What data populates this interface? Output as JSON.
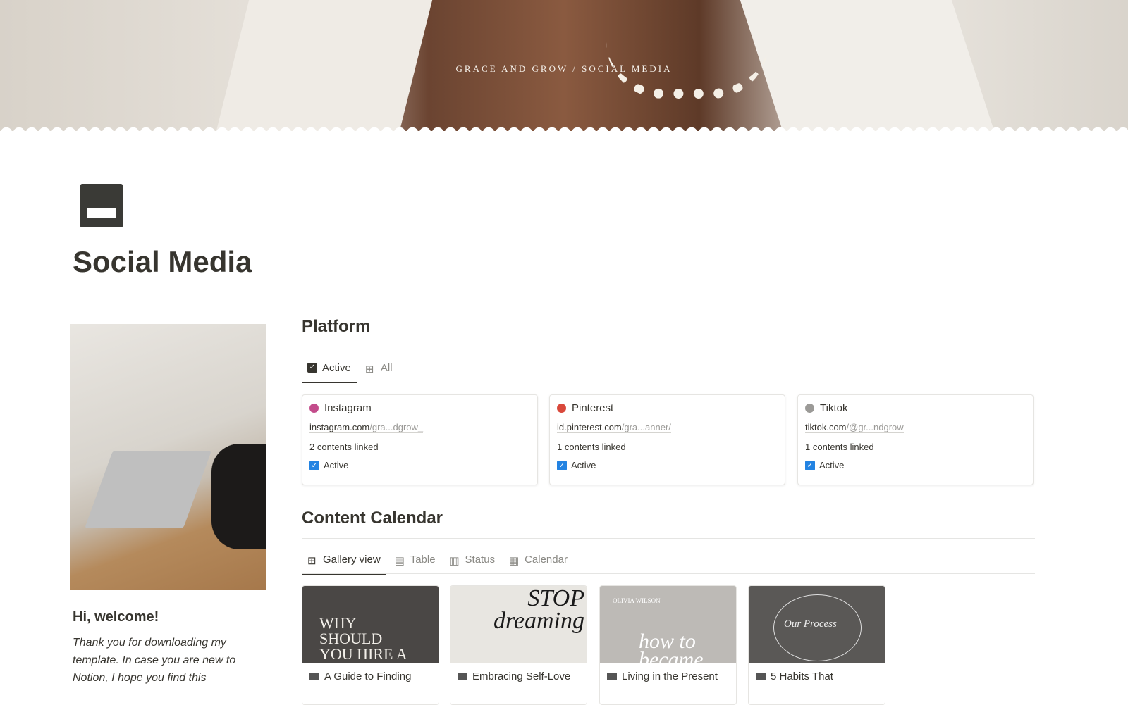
{
  "banner": {
    "title": "GRACE AND GROW / SOCIAL MEDIA"
  },
  "page": {
    "icon": "ticket-icon",
    "title": "Social Media"
  },
  "sidebar": {
    "welcome_title": "Hi, welcome!",
    "welcome_text": "Thank you for downloading my template. In case you are new to Notion, I hope you find this"
  },
  "platform": {
    "heading": "Platform",
    "tabs": [
      {
        "label": "Active",
        "icon": "checkbox-icon"
      },
      {
        "label": "All",
        "icon": "gallery-icon"
      }
    ],
    "cards": [
      {
        "name": "Instagram",
        "color": "#c34c8b",
        "url_domain": "instagram.com",
        "url_path": "/gra...dgrow_",
        "linked": "2 contents linked",
        "status": "Active"
      },
      {
        "name": "Pinterest",
        "color": "#d9483b",
        "url_domain": "id.pinterest.com",
        "url_path": "/gra...anner/",
        "linked": "1 contents linked",
        "status": "Active"
      },
      {
        "name": "Tiktok",
        "color": "#9b9a97",
        "url_domain": "tiktok.com",
        "url_path": "/@gr...ndgrow",
        "linked": "1 contents linked",
        "status": "Active"
      }
    ]
  },
  "calendar": {
    "heading": "Content Calendar",
    "tabs": [
      {
        "label": "Gallery view",
        "icon": "gallery-icon"
      },
      {
        "label": "Table",
        "icon": "table-icon"
      },
      {
        "label": "Status",
        "icon": "board-icon"
      },
      {
        "label": "Calendar",
        "icon": "calendar-icon"
      }
    ],
    "cards": [
      {
        "title": "A Guide to Finding",
        "image_text": "WHY SHOULD YOU HIRE A"
      },
      {
        "title": "Embracing Self-Love",
        "image_text": "STOP dreaming"
      },
      {
        "title": "Living in the Present",
        "image_text": "how to became",
        "brand": "OLIVIA WILSON"
      },
      {
        "title": "5 Habits That",
        "image_text": "Our Process"
      }
    ]
  }
}
